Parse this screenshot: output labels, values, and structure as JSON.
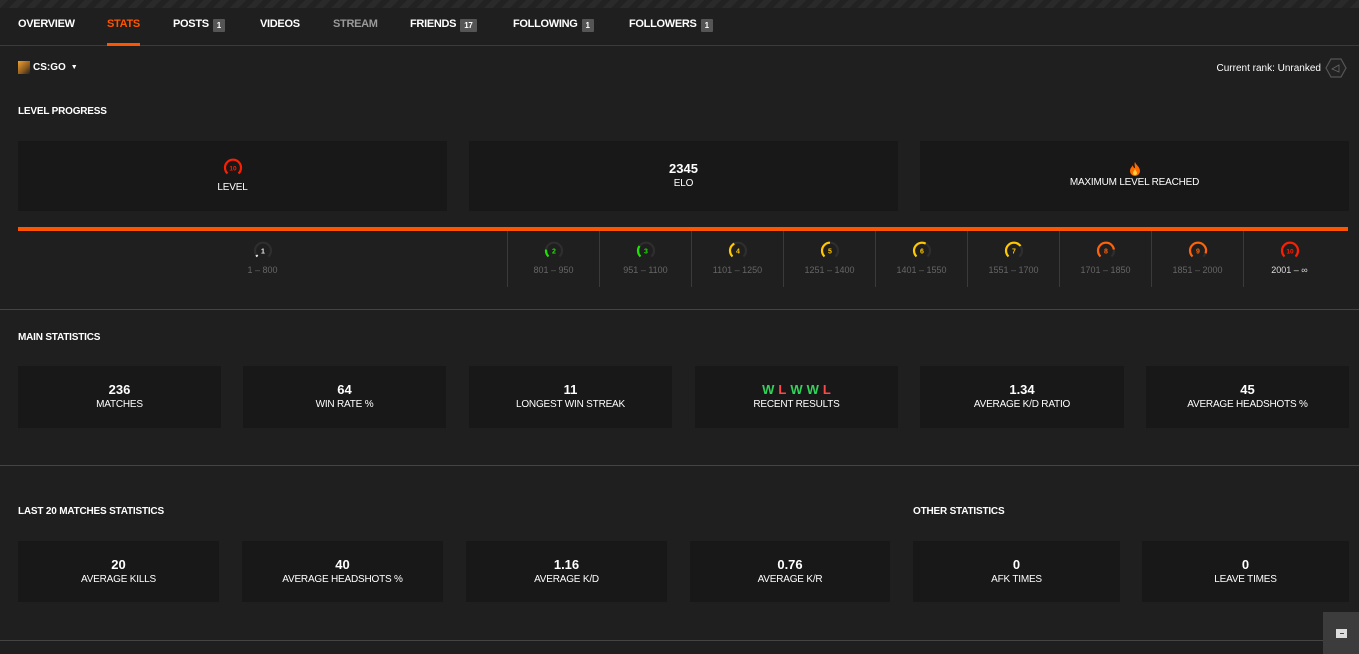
{
  "nav": {
    "tabs": [
      {
        "label": "OVERVIEW",
        "badge": null
      },
      {
        "label": "STATS",
        "badge": null,
        "active": true
      },
      {
        "label": "POSTS",
        "badge": "1"
      },
      {
        "label": "VIDEOS",
        "badge": null
      },
      {
        "label": "STREAM",
        "badge": null
      },
      {
        "label": "FRIENDS",
        "badge": "17"
      },
      {
        "label": "FOLLOWING",
        "badge": "1"
      },
      {
        "label": "FOLLOWERS",
        "badge": "1"
      }
    ]
  },
  "game_select": {
    "label": "CS:GO",
    "icon": "csgo-icon"
  },
  "rank": {
    "label": "Current rank: Unranked",
    "icon": "unranked-hexagon-icon"
  },
  "level_progress": {
    "title": "LEVEL PROGRESS",
    "cards": [
      {
        "value": "",
        "label": "LEVEL",
        "icon": "level-10-gauge-icon"
      },
      {
        "value": "2345",
        "label": "ELO"
      },
      {
        "value": "",
        "label": "MAXIMUM LEVEL REACHED",
        "icon": "fire-icon"
      }
    ],
    "progress_fraction": 1.0,
    "accent_color": "#ff5500",
    "levels": [
      {
        "level": "1",
        "range": "1 – 800",
        "color": "#eeeeee",
        "fill": 0.05
      },
      {
        "level": "2",
        "range": "801 – 950",
        "color": "#1ce400",
        "fill": 0.2
      },
      {
        "level": "3",
        "range": "951 – 1100",
        "color": "#1ce400",
        "fill": 0.3
      },
      {
        "level": "4",
        "range": "1101 – 1250",
        "color": "#ffc800",
        "fill": 0.4
      },
      {
        "level": "5",
        "range": "1251 – 1400",
        "color": "#ffc800",
        "fill": 0.5
      },
      {
        "level": "6",
        "range": "1401 – 1550",
        "color": "#ffc800",
        "fill": 0.6
      },
      {
        "level": "7",
        "range": "1551 – 1700",
        "color": "#ffc800",
        "fill": 0.7
      },
      {
        "level": "8",
        "range": "1701 – 1850",
        "color": "#ff6309",
        "fill": 0.8
      },
      {
        "level": "9",
        "range": "1851 – 2000",
        "color": "#ff6309",
        "fill": 0.9
      },
      {
        "level": "10",
        "range": "2001 – ∞",
        "color": "#fe1f00",
        "fill": 1.0,
        "current": true
      }
    ]
  },
  "main_statistics": {
    "title": "MAIN STATISTICS",
    "cards": [
      {
        "value": "236",
        "label": "MATCHES"
      },
      {
        "value": "64",
        "label": "WIN RATE %"
      },
      {
        "value": "11",
        "label": "LONGEST WIN STREAK"
      },
      {
        "value": "",
        "label": "RECENT RESULTS",
        "results": [
          "W",
          "L",
          "W",
          "W",
          "L"
        ]
      },
      {
        "value": "1.34",
        "label": "AVERAGE K/D RATIO"
      },
      {
        "value": "45",
        "label": "AVERAGE HEADSHOTS %"
      }
    ],
    "win_color": "#32d35a",
    "loss_color": "#ff4949"
  },
  "last20": {
    "title": "LAST 20 MATCHES STATISTICS",
    "cards": [
      {
        "value": "20",
        "label": "AVERAGE KILLS"
      },
      {
        "value": "40",
        "label": "AVERAGE HEADSHOTS %"
      },
      {
        "value": "1.16",
        "label": "AVERAGE K/D"
      },
      {
        "value": "0.76",
        "label": "AVERAGE K/R"
      }
    ]
  },
  "other": {
    "title": "OTHER STATISTICS",
    "cards": [
      {
        "value": "0",
        "label": "AFK TIMES"
      },
      {
        "value": "0",
        "label": "LEAVE TIMES"
      }
    ]
  },
  "chat": {
    "icon": "chat-icon"
  }
}
